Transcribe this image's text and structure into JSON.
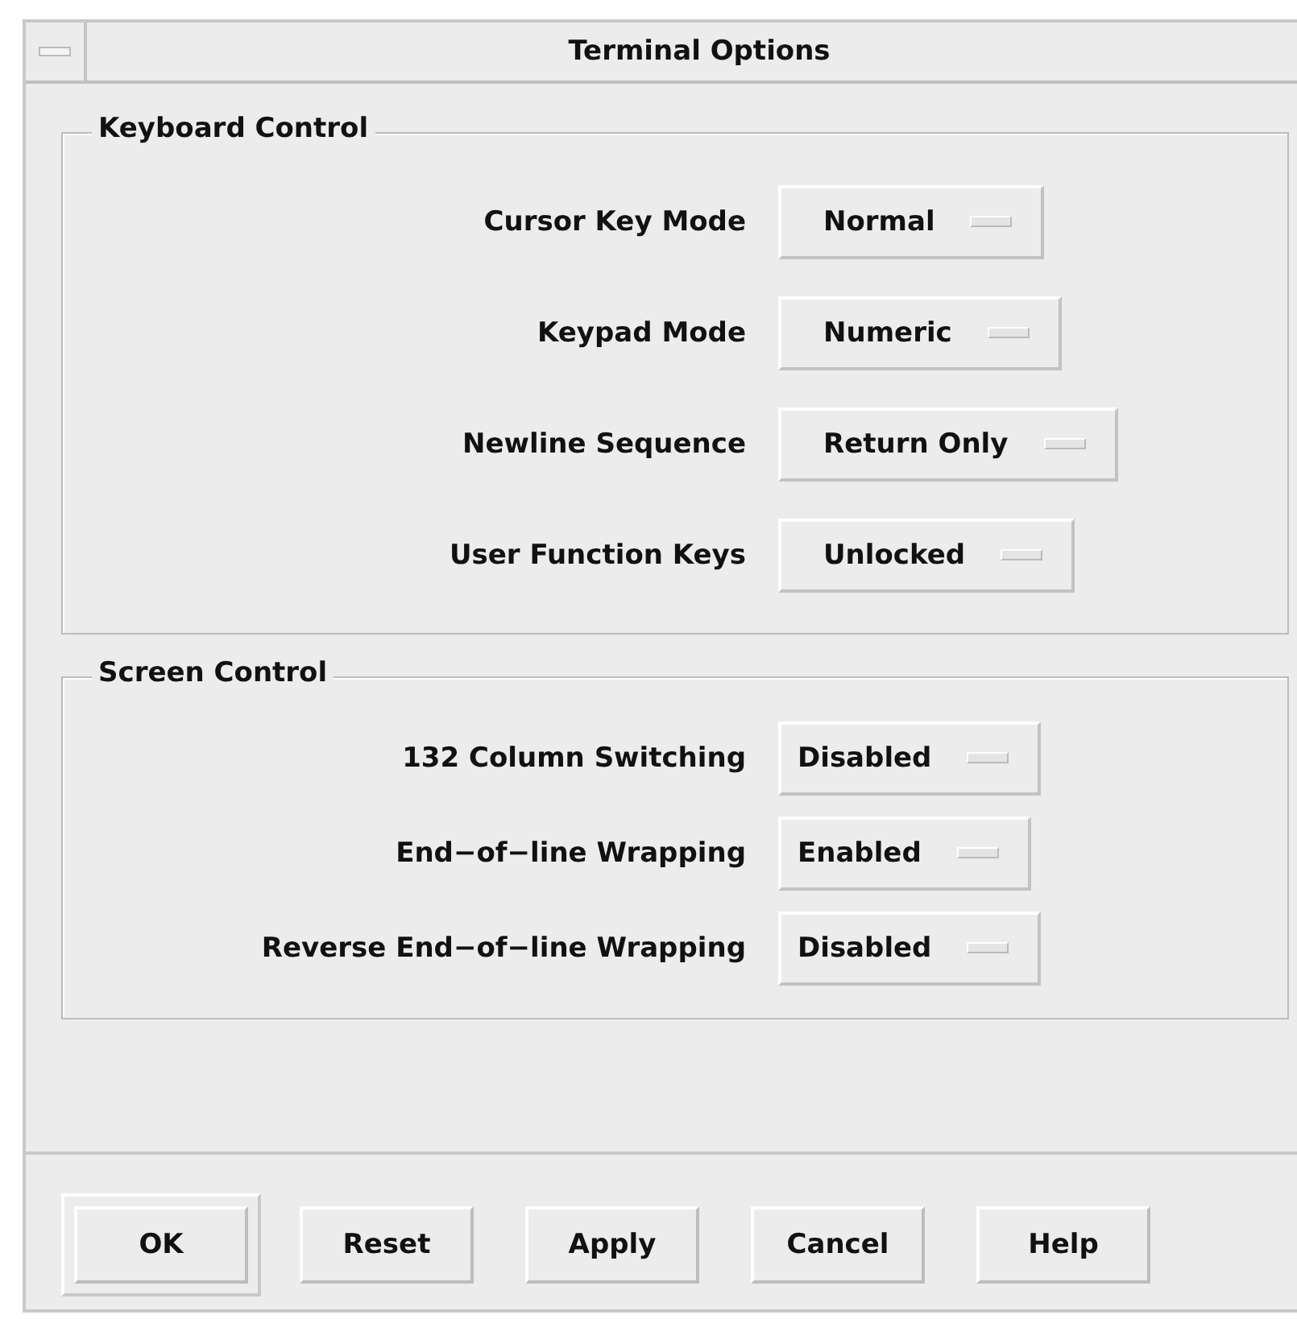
{
  "window": {
    "title": "Terminal Options"
  },
  "groups": [
    {
      "title": "Keyboard Control",
      "rows": [
        {
          "label": "Cursor Key Mode",
          "value": "Normal"
        },
        {
          "label": "Keypad Mode",
          "value": "Numeric"
        },
        {
          "label": "Newline Sequence",
          "value": "Return Only"
        },
        {
          "label": "User Function Keys",
          "value": "Unlocked"
        }
      ]
    },
    {
      "title": "Screen Control",
      "rows": [
        {
          "label": "132 Column Switching",
          "value": "Disabled"
        },
        {
          "label": "End−of−line Wrapping",
          "value": "Enabled"
        },
        {
          "label": "Reverse End−of−line Wrapping",
          "value": "Disabled"
        }
      ]
    }
  ],
  "buttons": [
    {
      "label": "OK",
      "default": true
    },
    {
      "label": "Reset",
      "default": false
    },
    {
      "label": "Apply",
      "default": false
    },
    {
      "label": "Cancel",
      "default": false
    },
    {
      "label": "Help",
      "default": false
    }
  ]
}
